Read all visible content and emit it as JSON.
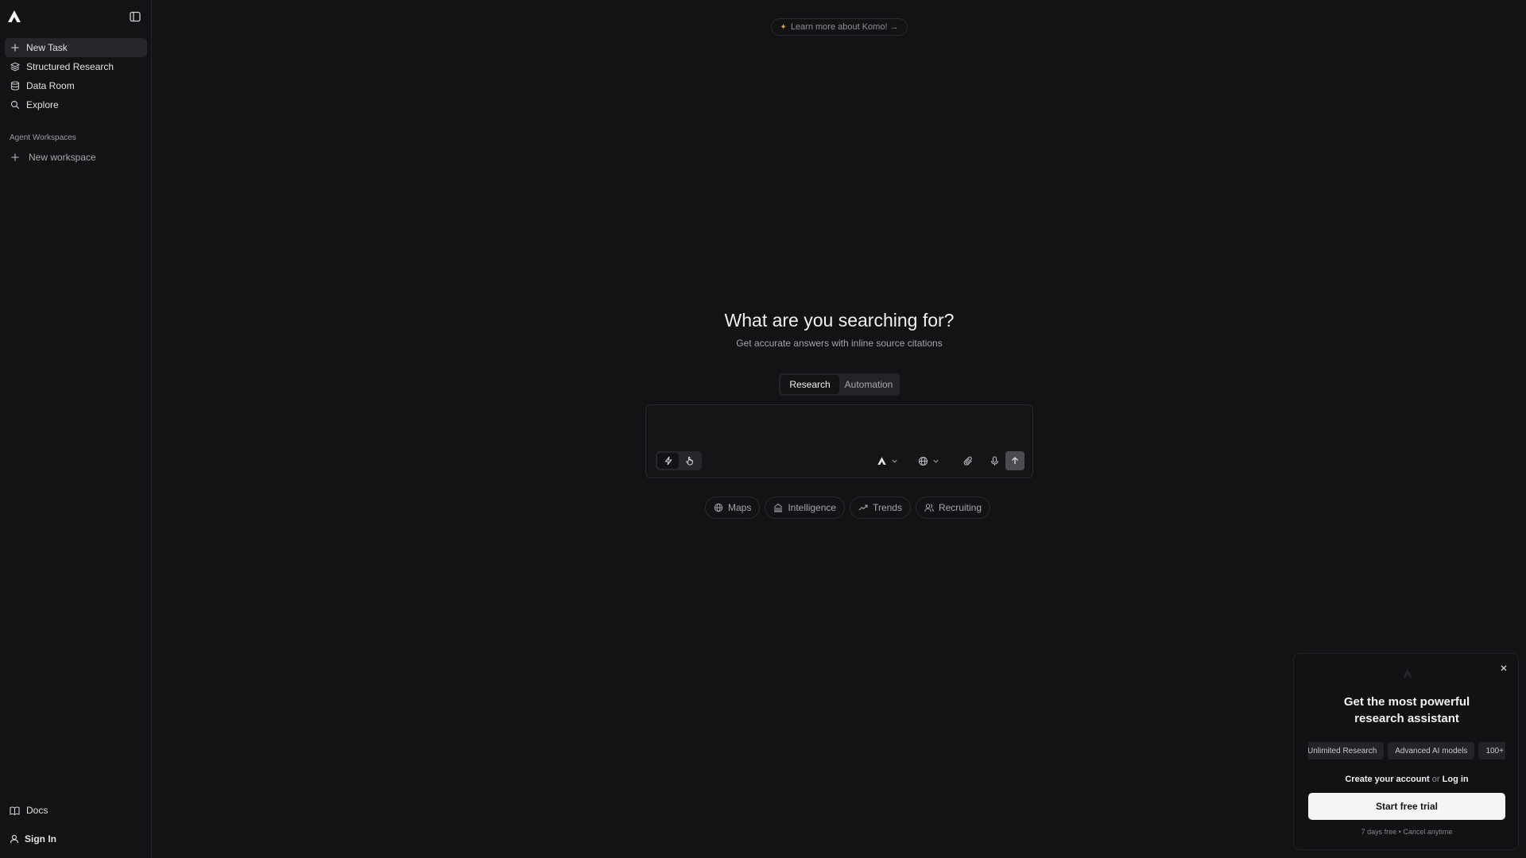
{
  "sidebar": {
    "logo_icon": "komo-logo-icon",
    "items": [
      {
        "label": "New Task",
        "icon": "plus-icon",
        "active": true
      },
      {
        "label": "Structured Research",
        "icon": "layers-icon"
      },
      {
        "label": "Data Room",
        "icon": "database-icon"
      },
      {
        "label": "Explore",
        "icon": "search-icon"
      }
    ],
    "section_label": "Agent Workspaces",
    "new_workspace": "New workspace",
    "docs": "Docs",
    "sign_in": "Sign In"
  },
  "top_pill": {
    "label": "Learn more about Komo! →",
    "spark_icon": "sparkle-icon"
  },
  "hero": {
    "title": "What are you searching for?",
    "subtitle": "Get accurate answers with inline source citations"
  },
  "modes": {
    "research": "Research",
    "automation": "Automation",
    "selected": "Research"
  },
  "composer": {
    "value": "",
    "placeholder": ""
  },
  "chips": [
    {
      "label": "Maps",
      "icon": "globe-icon"
    },
    {
      "label": "Intelligence",
      "icon": "building-icon"
    },
    {
      "label": "Trends",
      "icon": "trending-up-icon"
    },
    {
      "label": "Recruiting",
      "icon": "users-icon"
    }
  ],
  "popup": {
    "title_line1": "Get the most powerful",
    "title_line2": "research assistant",
    "features": [
      "Unlimited Research",
      "Advanced AI models",
      "100+"
    ],
    "create_account": "Create your account",
    "or": "or",
    "log_in": "Log in",
    "trial_button": "Start free trial",
    "note": "7 days free • Cancel anytime"
  },
  "colors": {
    "background": "#131315",
    "accent_spark": "#d2a74a",
    "primary_button": "#f5f5f7"
  }
}
